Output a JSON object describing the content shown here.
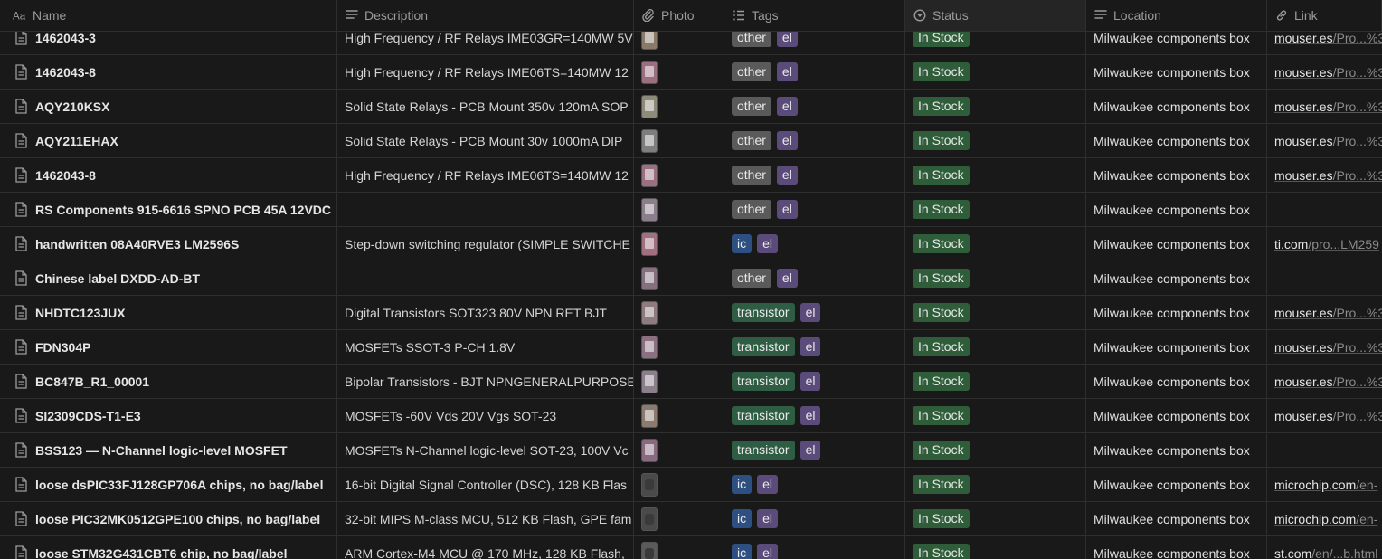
{
  "colors": {
    "background": "#191919",
    "tag_other": "#5a5a5a",
    "tag_el": "#5b4b7a",
    "tag_ic": "#2e4f82",
    "tag_transistor": "#2f5d44",
    "status_in_stock": "#2f5d3a"
  },
  "columns": [
    {
      "key": "name",
      "label": "Name",
      "icon": "text-aa-icon"
    },
    {
      "key": "description",
      "label": "Description",
      "icon": "lines-icon"
    },
    {
      "key": "photo",
      "label": "Photo",
      "icon": "paperclip-icon"
    },
    {
      "key": "tags",
      "label": "Tags",
      "icon": "list-icon"
    },
    {
      "key": "status",
      "label": "Status",
      "icon": "status-circle-icon"
    },
    {
      "key": "location",
      "label": "Location",
      "icon": "lines-icon"
    },
    {
      "key": "link",
      "label": "Link",
      "icon": "link-icon"
    }
  ],
  "rows": [
    {
      "name": "1462043-3",
      "description": "High Frequency / RF Relays IME03GR=140MW 5V",
      "photo": "light",
      "tags": [
        "other",
        "el"
      ],
      "status": "In Stock",
      "location": "Milwaukee components box",
      "link_host": "mouser.es",
      "link_path": "/Pro...%3"
    },
    {
      "name": "1462043-8",
      "description": "High Frequency / RF Relays IME06TS=140MW 12",
      "photo": "light",
      "tags": [
        "other",
        "el"
      ],
      "status": "In Stock",
      "location": "Milwaukee components box",
      "link_host": "mouser.es",
      "link_path": "/Pro...%3"
    },
    {
      "name": "AQY210KSX",
      "description": "Solid State Relays - PCB Mount 350v 120mA SOP",
      "photo": "light",
      "tags": [
        "other",
        "el"
      ],
      "status": "In Stock",
      "location": "Milwaukee components box",
      "link_host": "mouser.es",
      "link_path": "/Pro...%3"
    },
    {
      "name": "AQY211EHAX",
      "description": "Solid State Relays - PCB Mount 30v 1000mA DIP",
      "photo": "light",
      "tags": [
        "other",
        "el"
      ],
      "status": "In Stock",
      "location": "Milwaukee components box",
      "link_host": "mouser.es",
      "link_path": "/Pro...%3"
    },
    {
      "name": "1462043-8",
      "description": "High Frequency / RF Relays IME06TS=140MW 12",
      "photo": "light",
      "tags": [
        "other",
        "el"
      ],
      "status": "In Stock",
      "location": "Milwaukee components box",
      "link_host": "mouser.es",
      "link_path": "/Pro...%3"
    },
    {
      "name": "RS Components 915-6616 SPNO PCB 45A 12VDC",
      "description": "",
      "photo": "light",
      "tags": [
        "other",
        "el"
      ],
      "status": "In Stock",
      "location": "Milwaukee components box",
      "link_host": "",
      "link_path": ""
    },
    {
      "name": "handwritten 08A40RVE3 LM2596S",
      "description": "Step-down switching regulator (SIMPLE SWITCHE",
      "photo": "light",
      "tags": [
        "ic",
        "el"
      ],
      "status": "In Stock",
      "location": "Milwaukee components box",
      "link_host": "ti.com",
      "link_path": "/pro...LM259"
    },
    {
      "name": "Chinese label DXDD-AD-BT",
      "description": "",
      "photo": "light",
      "tags": [
        "other",
        "el"
      ],
      "status": "In Stock",
      "location": "Milwaukee components box",
      "link_host": "",
      "link_path": ""
    },
    {
      "name": "NHDTC123JUX",
      "description": "Digital Transistors SOT323 80V NPN RET BJT",
      "photo": "light",
      "tags": [
        "transistor",
        "el"
      ],
      "status": "In Stock",
      "location": "Milwaukee components box",
      "link_host": "mouser.es",
      "link_path": "/Pro...%3"
    },
    {
      "name": "FDN304P",
      "description": "MOSFETs SSOT-3 P-CH 1.8V",
      "photo": "light",
      "tags": [
        "transistor",
        "el"
      ],
      "status": "In Stock",
      "location": "Milwaukee components box",
      "link_host": "mouser.es",
      "link_path": "/Pro...%3"
    },
    {
      "name": "BC847B_R1_00001",
      "description": "Bipolar Transistors - BJT NPNGENERALPURPOSE",
      "photo": "light",
      "tags": [
        "transistor",
        "el"
      ],
      "status": "In Stock",
      "location": "Milwaukee components box",
      "link_host": "mouser.es",
      "link_path": "/Pro...%3"
    },
    {
      "name": "SI2309CDS-T1-E3",
      "description": "MOSFETs -60V Vds 20V Vgs SOT-23",
      "photo": "light",
      "tags": [
        "transistor",
        "el"
      ],
      "status": "In Stock",
      "location": "Milwaukee components box",
      "link_host": "mouser.es",
      "link_path": "/Pro...%3"
    },
    {
      "name": "BSS123 — N-Channel logic-level MOSFET",
      "description": "MOSFETs N-Channel logic-level SOT-23, 100V Vc",
      "photo": "light",
      "tags": [
        "transistor",
        "el"
      ],
      "status": "In Stock",
      "location": "Milwaukee components box",
      "link_host": "",
      "link_path": ""
    },
    {
      "name": "loose dsPIC33FJ128GP706A chips, no bag/label",
      "description": "16-bit Digital Signal Controller (DSC), 128 KB Flas",
      "photo": "dark",
      "tags": [
        "ic",
        "el"
      ],
      "status": "In Stock",
      "location": "Milwaukee components box",
      "link_host": "microchip.com",
      "link_path": "/en-"
    },
    {
      "name": "loose PIC32MK0512GPE100 chips, no bag/label",
      "description": "32-bit MIPS M-class MCU, 512 KB Flash, GPE fam",
      "photo": "dark",
      "tags": [
        "ic",
        "el"
      ],
      "status": "In Stock",
      "location": "Milwaukee components box",
      "link_host": "microchip.com",
      "link_path": "/en-"
    },
    {
      "name": "loose STM32G431CBT6 chip, no bag/label",
      "description": "ARM Cortex-M4 MCU @ 170 MHz, 128 KB Flash,",
      "photo": "dark",
      "tags": [
        "ic",
        "el"
      ],
      "status": "In Stock",
      "location": "Milwaukee components box",
      "link_host": "st.com",
      "link_path": "/en/...b.html"
    }
  ]
}
